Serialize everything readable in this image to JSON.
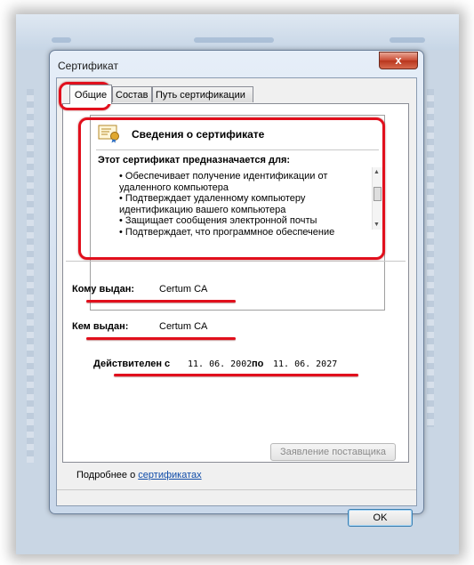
{
  "window": {
    "title": "Сертификат",
    "close_label": "x"
  },
  "tabs": [
    {
      "label": "Общие",
      "active": true
    },
    {
      "label": "Состав",
      "active": false
    },
    {
      "label": "Путь сертификации",
      "active": false
    }
  ],
  "info": {
    "icon": "certificate-icon",
    "title": "Сведения о сертификате",
    "purpose_heading": "Этот сертификат предназначается для:",
    "purposes": [
      "• Обеспечивает получение идентификации от",
      "удаленного компьютера",
      "• Подтверждает удаленному компьютеру",
      "идентификацию вашего компьютера",
      "• Защищает сообщения электронной почты",
      "• Подтверждает, что программное обеспечение"
    ]
  },
  "fields": {
    "issued_to_label": "Кому выдан:",
    "issued_to_value": "Certum CA",
    "issued_by_label": "Кем выдан:",
    "issued_by_value": "Certum CA",
    "valid_from_label": "Действителен с",
    "valid_from_value": "11. 06. 2002",
    "valid_to_label": "по",
    "valid_to_value": "11. 06. 2027"
  },
  "buttons": {
    "provider_statement": "Заявление поставщика",
    "ok": "OK"
  },
  "more_info": {
    "prefix": "Подробнее о ",
    "link": "сертификатах"
  },
  "colors": {
    "annotation": "#e10f1c",
    "link": "#0f4ba8"
  }
}
